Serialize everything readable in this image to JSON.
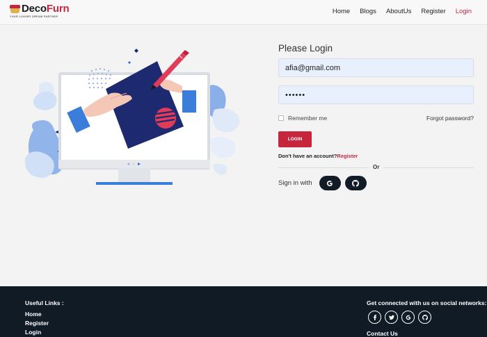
{
  "brand": {
    "name_part1": "Deco",
    "name_part2": "Furn",
    "tagline": "YOUR LUXURY DREAM PARTNER"
  },
  "nav": {
    "items": [
      {
        "label": "Home"
      },
      {
        "label": "Blogs"
      },
      {
        "label": "AboutUs"
      },
      {
        "label": "Register"
      },
      {
        "label": "Login",
        "active": true
      }
    ]
  },
  "login": {
    "title": "Please Login",
    "email_value": "afia@gmail.com",
    "password_value": "••••••",
    "remember_label": "Remember me",
    "forgot_label": "Forgot password?",
    "button_label": "LOGIN",
    "no_account_text": "Don't have an account?",
    "register_link": "Register",
    "or_text": "Or",
    "signin_with_label": "Sign in with",
    "social_icons": [
      "google-icon",
      "github-icon"
    ]
  },
  "footer": {
    "useful_links_title": "Useful Links :",
    "links": [
      "Home",
      "Register",
      "Login"
    ],
    "social_title": "Get connected with us on social networks:",
    "social_icons": [
      "facebook-icon",
      "twitter-icon",
      "google-icon",
      "github-icon"
    ],
    "contact_title": "Contact Us"
  },
  "colors": {
    "accent": "#c7253e",
    "footer_bg": "#101b26",
    "field_bg": "#e8f0fe"
  }
}
